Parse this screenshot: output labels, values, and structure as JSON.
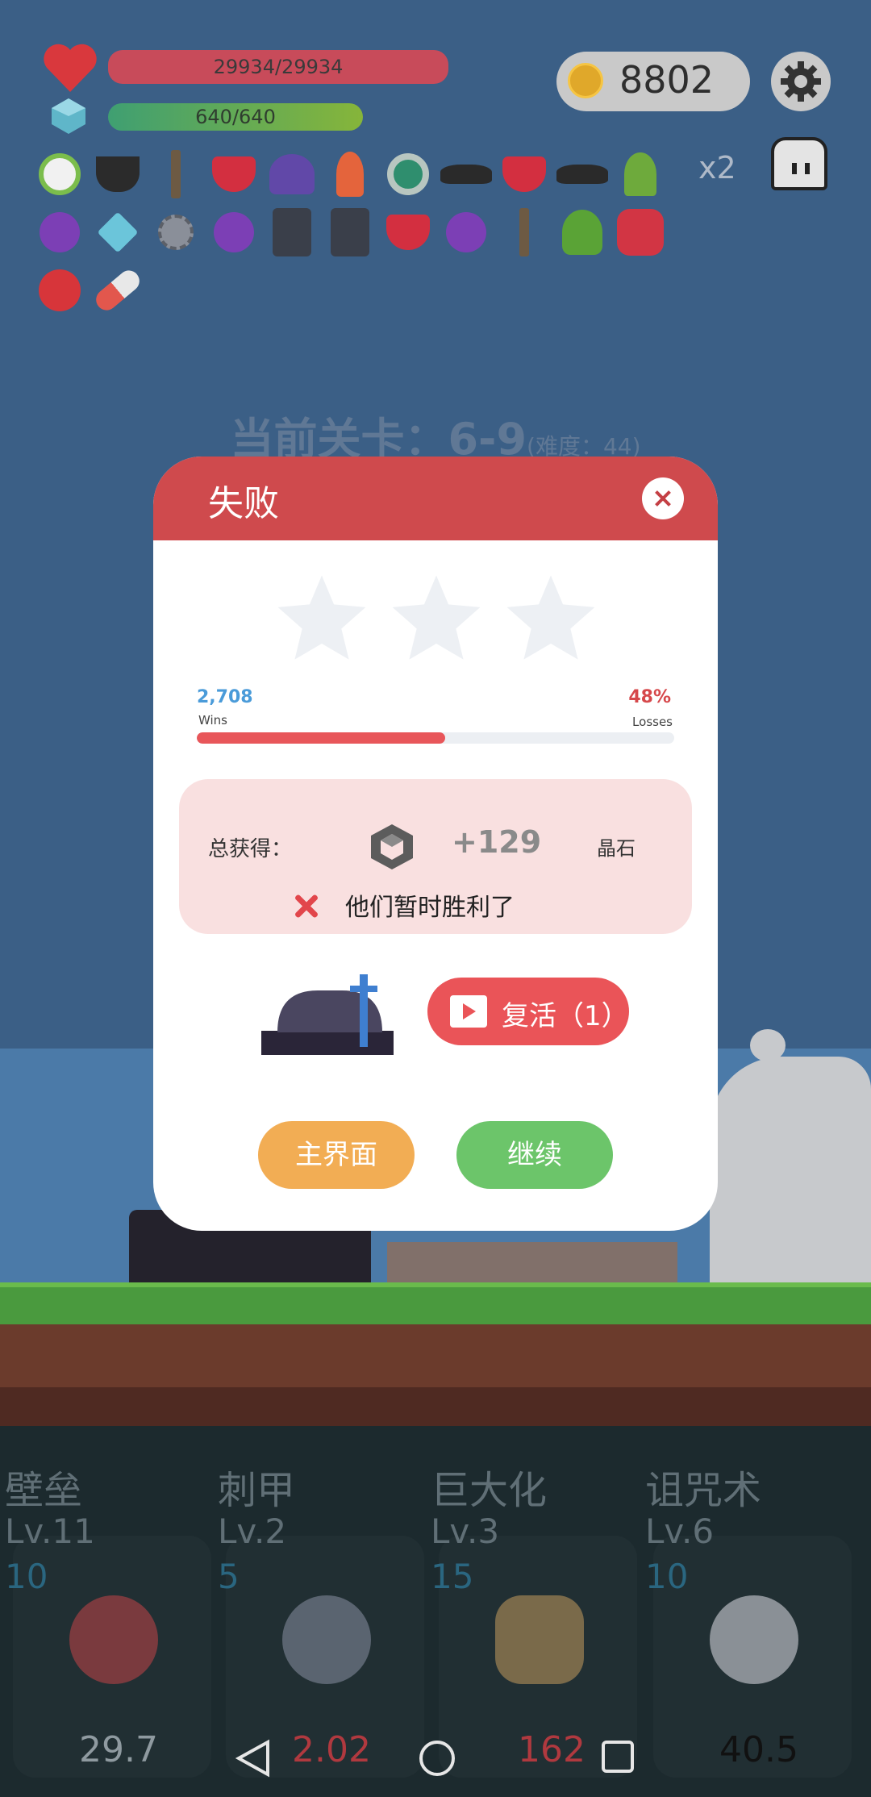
{
  "hud": {
    "hp_text": "29934/29934",
    "mp_text": "640/640",
    "coins": "8802",
    "multiplier": "x2"
  },
  "inventory_icons": [
    "flower-icon",
    "cauldron-icon",
    "sword-icon",
    "ruby-icon",
    "wizard-hat-icon",
    "torch-icon",
    "ring-icon",
    "bat-icon",
    "ruby-icon",
    "bat-icon",
    "tree-icon",
    "crystal-ball-icon",
    "diamond-icon",
    "spiked-ball-icon",
    "crystal-ball-icon",
    "spellbook-icon",
    "spellbook-icon",
    "ruby-icon",
    "crystal-ball-icon",
    "sword-icon",
    "monster-icon",
    "stop-gem-icon",
    "apple-icon",
    "pill-icon"
  ],
  "level": {
    "label": "当前关卡：6-9",
    "difficulty": "(难度：44)"
  },
  "dialog": {
    "title": "失败",
    "stars_earned": 0,
    "wins_value": "2,708",
    "wins_label": "Wins",
    "losses_value": "48%",
    "losses_label": "Losses",
    "win_fraction": 0.52,
    "reward_label": "总获得：",
    "reward_amount": "+129",
    "reward_unit": "晶石",
    "result_message": "他们暂时胜利了",
    "revive_label": "复活（1）",
    "main_menu_label": "主界面",
    "continue_label": "继续"
  },
  "skills": [
    {
      "name": "壁垒",
      "level": "Lv.11",
      "cost": "10",
      "value": "29.7",
      "value_color": "#8f9aa0"
    },
    {
      "name": "刺甲",
      "level": "Lv.2",
      "cost": "5",
      "value": "2.02",
      "value_color": "#b0393f"
    },
    {
      "name": "巨大化",
      "level": "Lv.3",
      "cost": "15",
      "value": "162",
      "value_color": "#b0393f"
    },
    {
      "name": "诅咒术",
      "level": "Lv.6",
      "cost": "10",
      "value": "40.5",
      "value_color": "#111111"
    }
  ],
  "colors": {
    "header_red": "#cf4a4d",
    "main_btn": "#f2ad54",
    "continue_btn": "#6cc56a",
    "revive_btn": "#ea5458"
  }
}
